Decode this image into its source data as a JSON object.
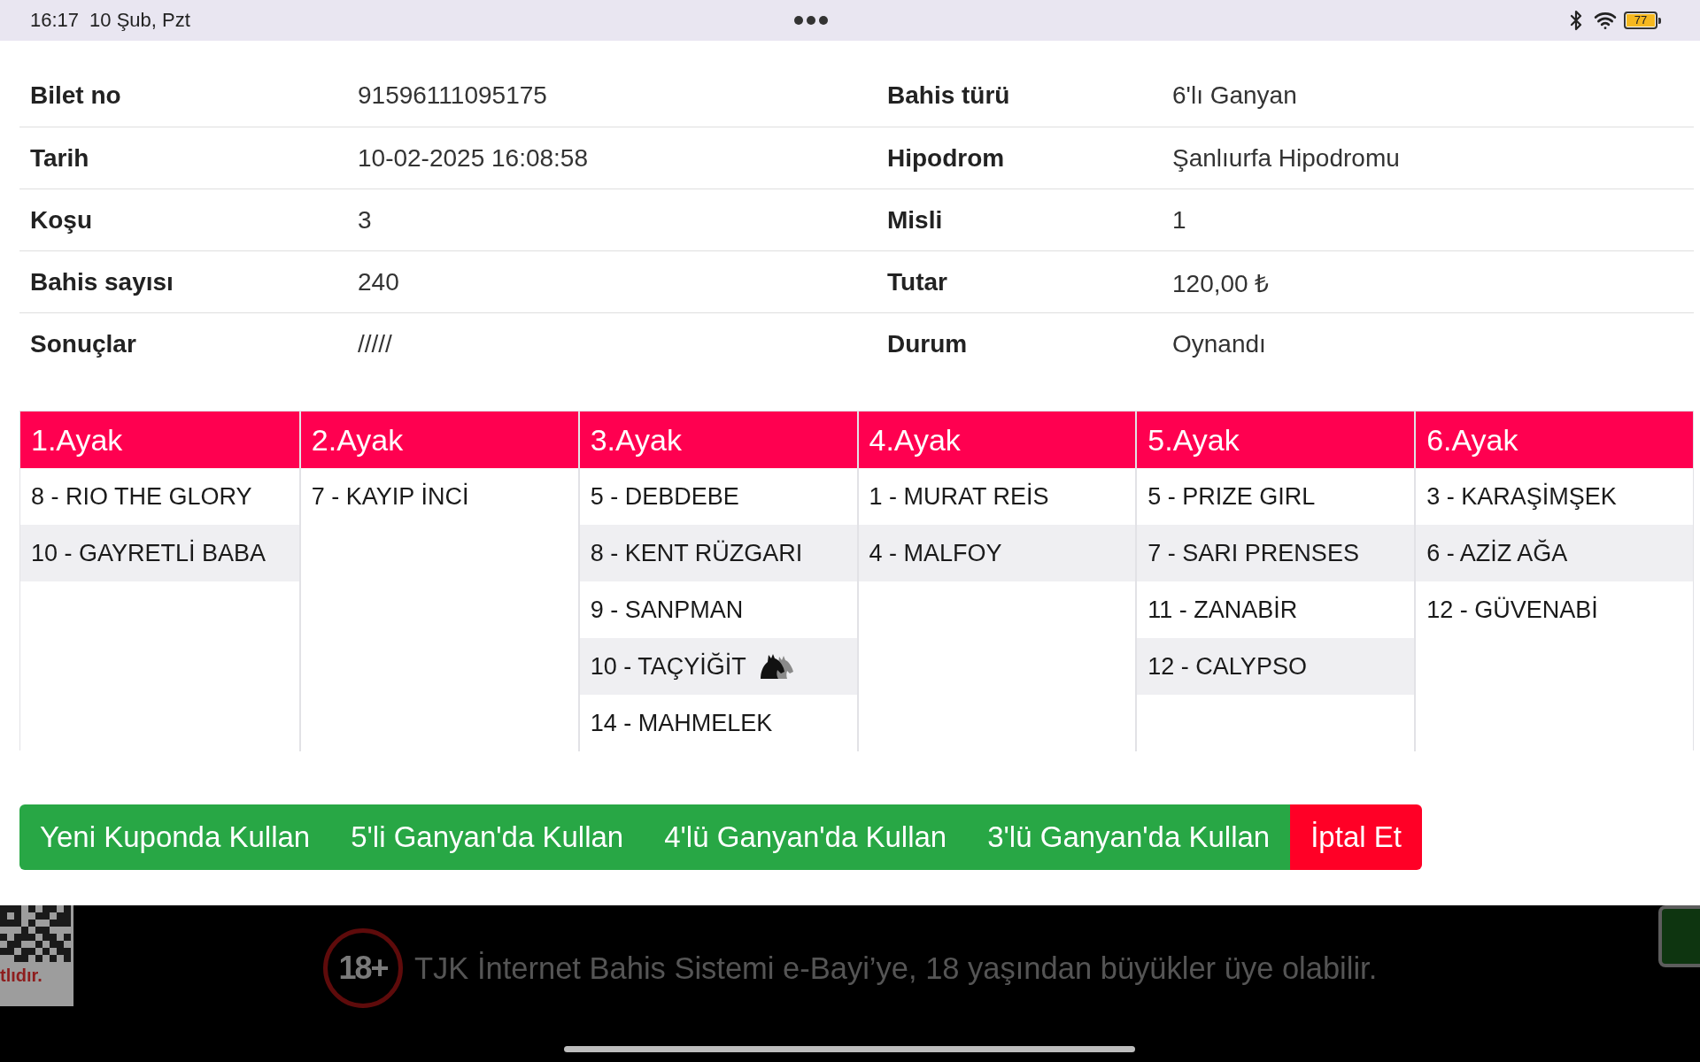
{
  "status_bar": {
    "time": "16:17",
    "date": "10 Şub, Pzt",
    "battery": "77"
  },
  "ticket_info": {
    "rows": [
      {
        "left": {
          "label": "Bilet no",
          "value": "91596111095175"
        },
        "right": {
          "label": "Bahis türü",
          "value": "6'lı Ganyan"
        }
      },
      {
        "left": {
          "label": "Tarih",
          "value": "10-02-2025 16:08:58"
        },
        "right": {
          "label": "Hipodrom",
          "value": "Şanlıurfa Hipodromu"
        }
      },
      {
        "left": {
          "label": "Koşu",
          "value": "3"
        },
        "right": {
          "label": "Misli",
          "value": "1"
        }
      },
      {
        "left": {
          "label": "Bahis sayısı",
          "value": "240"
        },
        "right": {
          "label": "Tutar",
          "value": "120,00 ₺"
        }
      },
      {
        "left": {
          "label": "Sonuçlar",
          "value": "/////"
        },
        "right": {
          "label": "Durum",
          "value": "Oynandı"
        }
      }
    ]
  },
  "legs": [
    {
      "title": "1.Ayak",
      "runners": [
        {
          "name": "8 - RIO THE GLORY",
          "horse_icon": false
        },
        {
          "name": "10 - GAYRETLİ BABA",
          "horse_icon": false
        }
      ]
    },
    {
      "title": "2.Ayak",
      "runners": [
        {
          "name": "7 - KAYIP İNCİ",
          "horse_icon": false
        }
      ]
    },
    {
      "title": "3.Ayak",
      "runners": [
        {
          "name": "5 - DEBDEBE",
          "horse_icon": false
        },
        {
          "name": "8 - KENT RÜZGARI",
          "horse_icon": false
        },
        {
          "name": "9 - SANPMAN",
          "horse_icon": false
        },
        {
          "name": "10 - TAÇYİĞİT",
          "horse_icon": true
        },
        {
          "name": "14 - MAHMELEK",
          "horse_icon": false
        }
      ]
    },
    {
      "title": "4.Ayak",
      "runners": [
        {
          "name": "1 - MURAT REİS",
          "horse_icon": false
        },
        {
          "name": "4 - MALFOY",
          "horse_icon": false
        }
      ]
    },
    {
      "title": "5.Ayak",
      "runners": [
        {
          "name": "5 - PRIZE GIRL",
          "horse_icon": false
        },
        {
          "name": "7 - SARI PRENSES",
          "horse_icon": false
        },
        {
          "name": "11 - ZANABİR",
          "horse_icon": false
        },
        {
          "name": "12 - CALYPSO",
          "horse_icon": false
        }
      ]
    },
    {
      "title": "6.Ayak",
      "runners": [
        {
          "name": "3 - KARAŞİMŞEK",
          "horse_icon": false
        },
        {
          "name": "6 - AZİZ AĞA",
          "horse_icon": false
        },
        {
          "name": "12 - GÜVENABİ",
          "horse_icon": false
        }
      ]
    }
  ],
  "actions": [
    {
      "label": "Yeni Kuponda Kullan",
      "kind": "reuse"
    },
    {
      "label": "5'li Ganyan'da Kullan",
      "kind": "reuse"
    },
    {
      "label": "4'lü Ganyan'da Kullan",
      "kind": "reuse"
    },
    {
      "label": "3'lü Ganyan'da Kullan",
      "kind": "reuse"
    },
    {
      "label": "İptal Et",
      "kind": "cancel"
    }
  ],
  "footer": {
    "qr_caption": "tlıdır.",
    "age_badge": "18+",
    "notice": "TJK İnternet Bahis Sistemi e-Bayi’ye, 18 yaşından büyükler üye olabilir."
  }
}
